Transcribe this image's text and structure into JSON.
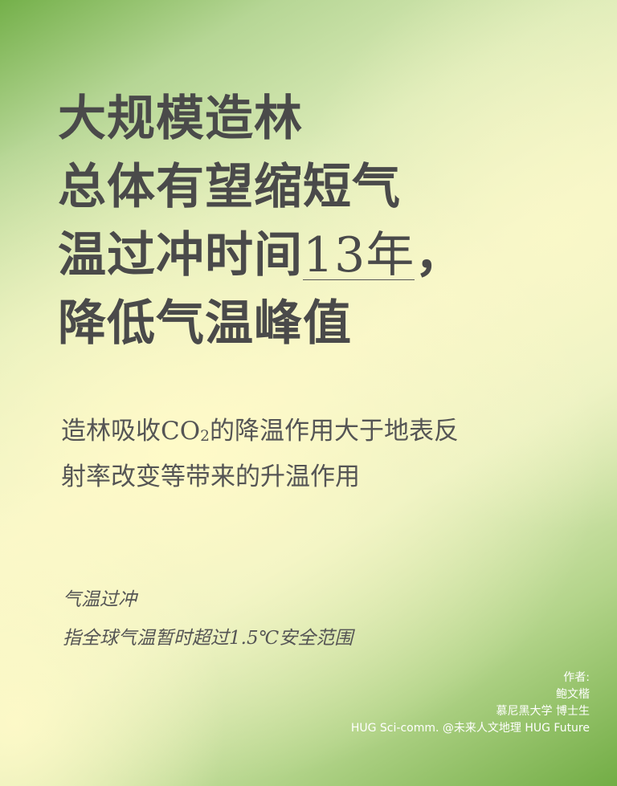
{
  "title": {
    "line1": "大规模造林",
    "line2": "总体有望缩短气",
    "line3_prefix": "温过冲时间",
    "line3_highlight": "13年",
    "line3_suffix": "，",
    "line4": "降低气温峰值"
  },
  "subtitle": {
    "line1_before": "造林吸收CO",
    "line1_sub": "2",
    "line1_after": "的降温作用大于地表反",
    "line2": "射率改变等带来的升温作用"
  },
  "note": {
    "term": "气温过冲",
    "definition": "指全球气温暂时超过1.5℃安全范围"
  },
  "credits": {
    "label": "作者:",
    "author": "鲍文楷",
    "affiliation": "慕尼黑大学 博士生",
    "source": "HUG Sci-comm.  @未来人文地理 HUG Future"
  }
}
